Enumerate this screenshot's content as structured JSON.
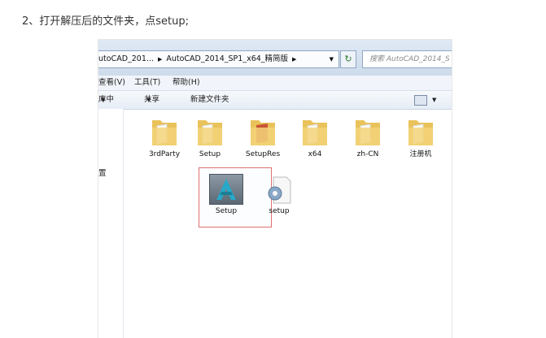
{
  "step_text": "2、打开解压后的文件夹，点setup;",
  "explorer": {
    "breadcrumb": [
      "utoCAD_201...",
      "AutoCAD_2014_SP1_x64_精简版"
    ],
    "search_placeholder": "搜索 AutoCAD_2014_S",
    "menu": [
      "查看(V)",
      "工具(T)",
      "帮助(H)"
    ],
    "toolbar": [
      "库中",
      "共享",
      "新建文件夹"
    ],
    "nav_label": "置",
    "folders": [
      "3rdParty",
      "Setup",
      "SetupRes",
      "x64",
      "zh-CN",
      "注册机"
    ],
    "files": [
      "Setup",
      "setup"
    ]
  }
}
